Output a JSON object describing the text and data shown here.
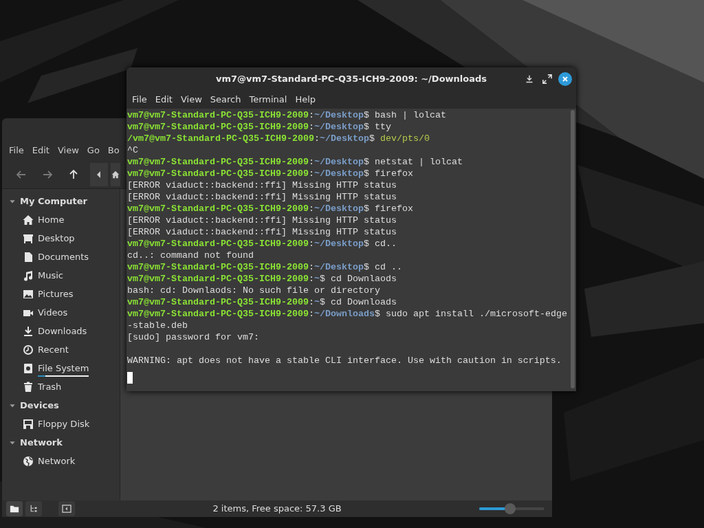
{
  "file_manager": {
    "menu": [
      "File",
      "Edit",
      "View",
      "Go",
      "Bo"
    ],
    "nav_buttons": [
      {
        "disabled": true
      },
      {
        "disabled": true
      },
      {
        "disabled": false
      }
    ],
    "sidebar": [
      {
        "title": "My Computer",
        "expanded": true,
        "items": [
          {
            "label": "Home"
          },
          {
            "label": "Desktop"
          },
          {
            "label": "Documents"
          },
          {
            "label": "Music"
          },
          {
            "label": "Pictures"
          },
          {
            "label": "Videos"
          },
          {
            "label": "Downloads"
          },
          {
            "label": "Recent"
          },
          {
            "label": "File System",
            "level": 0.15
          },
          {
            "label": "Trash"
          }
        ]
      },
      {
        "title": "Devices",
        "expanded": true,
        "items": [
          {
            "label": "Floppy Disk"
          }
        ]
      },
      {
        "title": "Network",
        "expanded": true,
        "items": [
          {
            "label": "Network"
          }
        ]
      }
    ],
    "status_bar": {
      "text": "2 items, Free space: 57.3 GB",
      "zoom": {
        "level": 0.48
      }
    }
  },
  "terminal": {
    "title": "vm7@vm7-Standard-PC-Q35-ICH9-2009: ~/Downloads",
    "menu": [
      "File",
      "Edit",
      "View",
      "Search",
      "Terminal",
      "Help"
    ],
    "lines": [
      {
        "kind": "prompt",
        "user": "vm7@vm7-Standard-PC-Q35-ICH9-2009",
        "sep": ":",
        "path": "~/Desktop",
        "sign": "$",
        "command": "bash | lolcat"
      },
      {
        "kind": "prompt",
        "user": "vm7@vm7-Standard-PC-Q35-ICH9-2009",
        "sep": ":",
        "path": "~/Desktop",
        "sign": "$",
        "command": "tty"
      },
      {
        "kind": "tty",
        "user": "/vm7@vm7-Standard-PC-Q35-ICH9-2009",
        "sep": ":",
        "path": "~/Desktop",
        "sign": "$",
        "command": "dev/pts/0"
      },
      {
        "kind": "output",
        "text": "^C"
      },
      {
        "kind": "prompt",
        "user": "vm7@vm7-Standard-PC-Q35-ICH9-2009",
        "sep": ":",
        "path": "~/Desktop",
        "sign": "$",
        "command": "netstat | lolcat"
      },
      {
        "kind": "prompt",
        "user": "vm7@vm7-Standard-PC-Q35-ICH9-2009",
        "sep": ":",
        "path": "~/Desktop",
        "sign": "$",
        "command": "firefox"
      },
      {
        "kind": "output",
        "text": "[ERROR viaduct::backend::ffi] Missing HTTP status"
      },
      {
        "kind": "output",
        "text": "[ERROR viaduct::backend::ffi] Missing HTTP status"
      },
      {
        "kind": "prompt",
        "user": "vm7@vm7-Standard-PC-Q35-ICH9-2009",
        "sep": ":",
        "path": "~/Desktop",
        "sign": "$",
        "command": "firefox"
      },
      {
        "kind": "output",
        "text": "[ERROR viaduct::backend::ffi] Missing HTTP status"
      },
      {
        "kind": "output",
        "text": "[ERROR viaduct::backend::ffi] Missing HTTP status"
      },
      {
        "kind": "prompt",
        "user": "vm7@vm7-Standard-PC-Q35-ICH9-2009",
        "sep": ":",
        "path": "~/Desktop",
        "sign": "$",
        "command": "cd.."
      },
      {
        "kind": "output",
        "text": "cd..: command not found"
      },
      {
        "kind": "prompt",
        "user": "vm7@vm7-Standard-PC-Q35-ICH9-2009",
        "sep": ":",
        "path": "~/Desktop",
        "sign": "$",
        "command": "cd .."
      },
      {
        "kind": "prompt",
        "user": "vm7@vm7-Standard-PC-Q35-ICH9-2009",
        "sep": ":",
        "path": "~",
        "sign": "$",
        "command": "cd Downlaods"
      },
      {
        "kind": "output",
        "text": "bash: cd: Downlaods: No such file or directory"
      },
      {
        "kind": "prompt",
        "user": "vm7@vm7-Standard-PC-Q35-ICH9-2009",
        "sep": ":",
        "path": "~",
        "sign": "$",
        "command": "cd Downloads"
      },
      {
        "kind": "prompt",
        "user": "vm7@vm7-Standard-PC-Q35-ICH9-2009",
        "sep": ":",
        "path": "~/Downloads",
        "sign": "$",
        "command": "sudo apt install ./microsoft-edge"
      },
      {
        "kind": "output",
        "text": "-stable.deb"
      },
      {
        "kind": "output",
        "text": "[sudo] password for vm7:"
      },
      {
        "kind": "blank"
      },
      {
        "kind": "output",
        "text": "WARNING: apt does not have a stable CLI interface. Use with caution in scripts."
      },
      {
        "kind": "cursor"
      }
    ]
  }
}
